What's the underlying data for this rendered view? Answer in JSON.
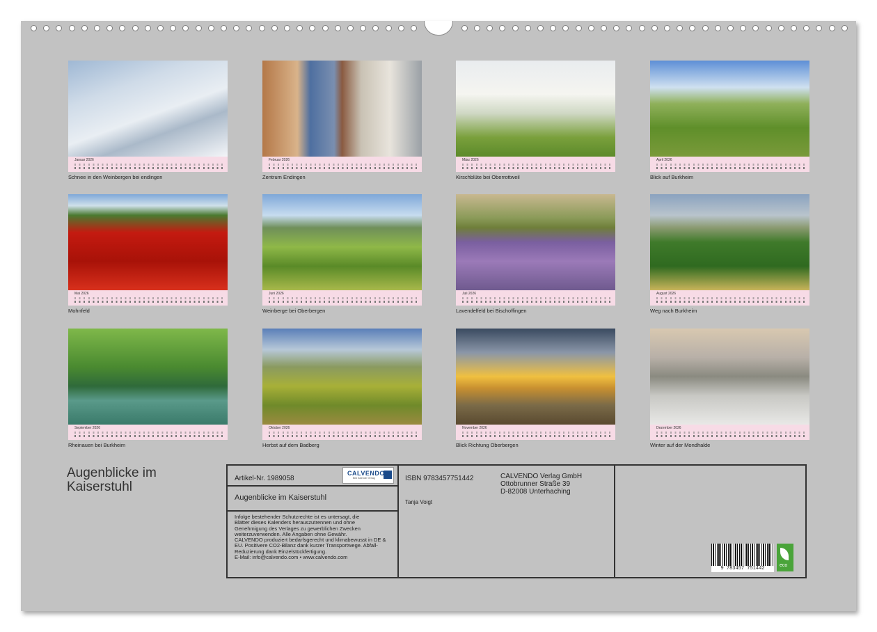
{
  "months": [
    {
      "month": "Januar",
      "caption": "Schnee in den Weinbergen bei endingen",
      "icon": "snowy-vineyard-photo"
    },
    {
      "month": "Februar",
      "caption": "Zentrum Endingen",
      "icon": "town-gate-photo"
    },
    {
      "month": "März",
      "caption": "Kirschblüte bei Oberrottweil",
      "icon": "cherry-blossom-photo"
    },
    {
      "month": "April",
      "caption": "Blick auf Burkheim",
      "icon": "burkheim-view-photo"
    },
    {
      "month": "Mai",
      "caption": "Mohnfeld",
      "icon": "poppy-field-photo"
    },
    {
      "month": "Juni",
      "caption": "Weinberge bei Oberbergen",
      "icon": "vineyard-hills-photo"
    },
    {
      "month": "Juli",
      "caption": "Lavendelfeld bei Bischoffingen",
      "icon": "lavender-field-photo"
    },
    {
      "month": "August",
      "caption": "Weg nach Burkheim",
      "icon": "path-vineyard-photo"
    },
    {
      "month": "September",
      "caption": "Rheinauen bei Burkheim",
      "icon": "river-meadow-photo"
    },
    {
      "month": "Oktober",
      "caption": "Herbst auf dem Badberg",
      "icon": "autumn-hills-photo"
    },
    {
      "month": "November",
      "caption": "Blick Richtung Oberbergen",
      "icon": "sunset-photo"
    },
    {
      "month": "Dezember",
      "caption": "Winter auf der Mondhalde",
      "icon": "frost-hills-photo"
    }
  ],
  "year": "2026",
  "title_line1": "Augenblicke im",
  "title_line2": "Kaiserstuhl",
  "info": {
    "article": "Artikel-Nr. 1989058",
    "logo_text": "CALVENDO",
    "logo_sub": "Bild Kalender Verlag",
    "product_title": "Augenblicke im Kaiserstuhl",
    "legal": [
      "Infolge bestehender Schutzrechte ist es untersagt, die",
      "Blätter dieses Kalenders herauszutrennen und ohne",
      "Genehmigung des Verlages zu gewerblichen Zwecken",
      "weiterzuverwenden. Alle Angaben ohne Gewähr.",
      "CALVENDO produziert bedarfsgerecht und klimabewusst in DE &",
      "EU. Positivere CO2-Bilanz dank kurzer Transportwege. Abfall-",
      "Reduzierung dank Einzelstückfertigung.",
      "E-Mail: info@calvendo.com • www.calvendo.com"
    ],
    "isbn": "ISBN 9783457751442",
    "author": "Tanja Voigt",
    "publisher": [
      "CALVENDO Verlag GmbH",
      "Ottobrunner Straße 39",
      "D-82008 Unterhaching"
    ],
    "barcode_digits": "9  783457  751442",
    "eco_label": "eco"
  },
  "colors": {
    "sheet": "#c2c2c2",
    "calendar_strip": "#f7dbe6"
  }
}
